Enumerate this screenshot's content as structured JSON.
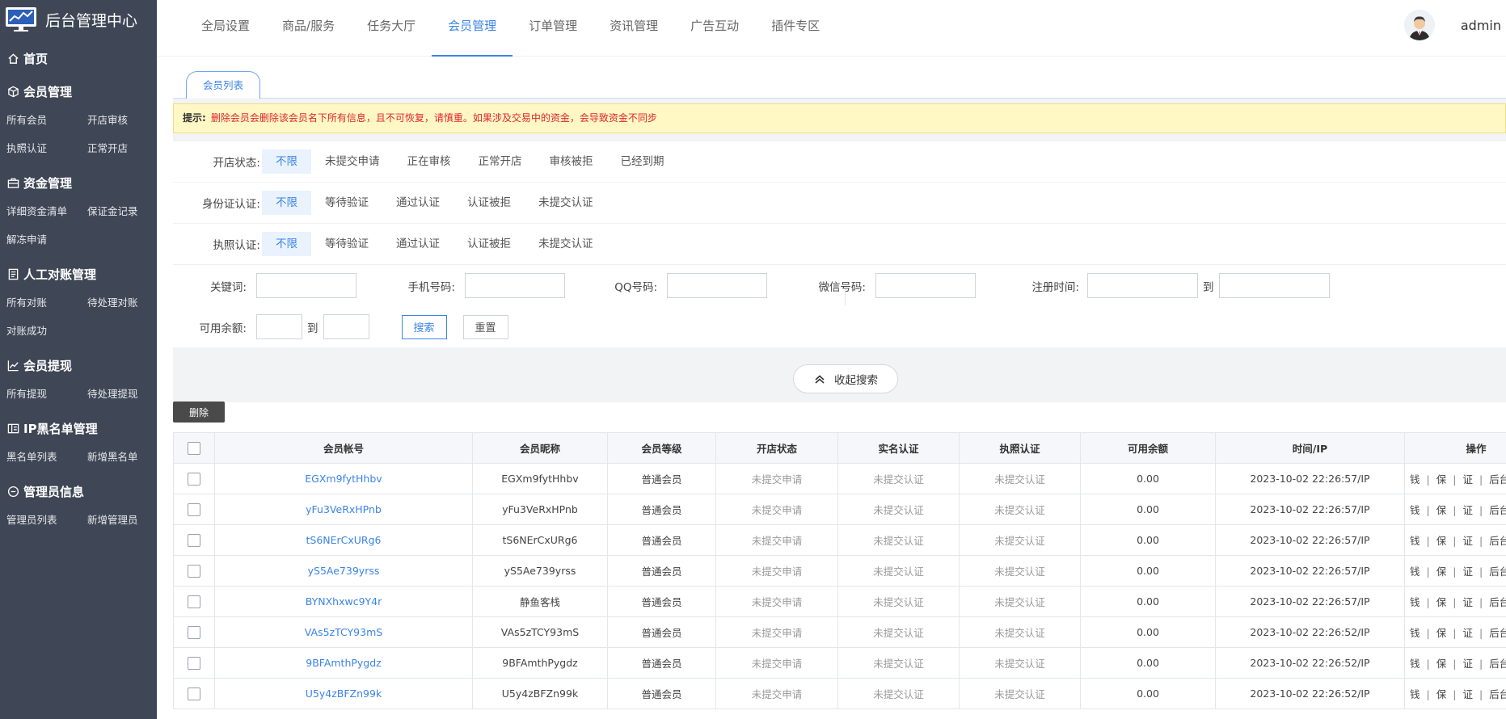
{
  "brand": {
    "title": "后台管理中心"
  },
  "sidebar": {
    "home": "首页",
    "groups": [
      {
        "title": "会员管理",
        "icon": "cube-icon",
        "items": [
          "所有会员",
          "开店审核",
          "执照认证",
          "正常开店"
        ]
      },
      {
        "title": "资金管理",
        "icon": "briefcase-icon",
        "items": [
          "详细资金清单",
          "保证金记录",
          "解冻申请"
        ]
      },
      {
        "title": "人工对账管理",
        "icon": "document-icon",
        "items": [
          "所有对账",
          "待处理对账",
          "对账成功"
        ]
      },
      {
        "title": "会员提现",
        "icon": "trend-chart-icon",
        "items": [
          "所有提现",
          "待处理提现"
        ]
      },
      {
        "title": "IP黑名单管理",
        "icon": "blacklist-icon",
        "items": [
          "黑名单列表",
          "新增黑名单"
        ]
      },
      {
        "title": "管理员信息",
        "icon": "minus-circle-icon",
        "items": [
          "管理员列表",
          "新增管理员"
        ]
      }
    ]
  },
  "topnav": {
    "items": [
      "全局设置",
      "商品/服务",
      "任务大厅",
      "会员管理",
      "订单管理",
      "资讯管理",
      "广告互动",
      "插件专区"
    ],
    "active_index": 3
  },
  "user": {
    "name": "admin"
  },
  "tab": {
    "label": "会员列表"
  },
  "notice": {
    "label": "提示:",
    "text": "删除会员会删除该会员名下所有信息，且不可恢复，请慎重。如果涉及交易中的资金，会导致资金不同步"
  },
  "filters": {
    "shop_status": {
      "label": "开店状态:",
      "options": [
        "不限",
        "未提交申请",
        "正在审核",
        "正常开店",
        "审核被拒",
        "已经到期"
      ],
      "active": 0
    },
    "id_auth": {
      "label": "身份证认证:",
      "options": [
        "不限",
        "等待验证",
        "通过认证",
        "认证被拒",
        "未提交认证"
      ],
      "active": 0
    },
    "license_auth": {
      "label": "执照认证:",
      "options": [
        "不限",
        "等待验证",
        "通过认证",
        "认证被拒",
        "未提交认证"
      ],
      "active": 0
    },
    "keyword_label": "关键词:",
    "phone_label": "手机号码:",
    "qq_label": "QQ号码:",
    "wechat_label": "微信号码:",
    "regtime_label": "注册时间:",
    "to_label": "到",
    "balance_label": "可用余额:",
    "search_btn": "搜索",
    "reset_btn": "重置"
  },
  "collapse": {
    "label": "收起搜索"
  },
  "delete_btn": "删除",
  "table": {
    "headers": [
      "会员帐号",
      "会员昵称",
      "会员等级",
      "开店状态",
      "实名认证",
      "执照认证",
      "可用余额",
      "时间/IP",
      "操作"
    ],
    "ops": [
      "钱",
      "保",
      "证",
      "后台"
    ],
    "rows": [
      {
        "account": "EGXm9fytHhbv",
        "nickname": "EGXm9fytHhbv",
        "level": "普通会员",
        "shop": "未提交申请",
        "realname": "未提交认证",
        "license": "未提交认证",
        "balance": "0.00",
        "time": "2023-10-02 22:26:57/IP"
      },
      {
        "account": "yFu3VeRxHPnb",
        "nickname": "yFu3VeRxHPnb",
        "level": "普通会员",
        "shop": "未提交申请",
        "realname": "未提交认证",
        "license": "未提交认证",
        "balance": "0.00",
        "time": "2023-10-02 22:26:57/IP"
      },
      {
        "account": "tS6NErCxURg6",
        "nickname": "tS6NErCxURg6",
        "level": "普通会员",
        "shop": "未提交申请",
        "realname": "未提交认证",
        "license": "未提交认证",
        "balance": "0.00",
        "time": "2023-10-02 22:26:57/IP"
      },
      {
        "account": "yS5Ae739yrss",
        "nickname": "yS5Ae739yrss",
        "level": "普通会员",
        "shop": "未提交申请",
        "realname": "未提交认证",
        "license": "未提交认证",
        "balance": "0.00",
        "time": "2023-10-02 22:26:57/IP"
      },
      {
        "account": "BYNXhxwc9Y4r",
        "nickname": "静鱼客栈",
        "level": "普通会员",
        "shop": "未提交申请",
        "realname": "未提交认证",
        "license": "未提交认证",
        "balance": "0.00",
        "time": "2023-10-02 22:26:57/IP"
      },
      {
        "account": "VAs5zTCY93mS",
        "nickname": "VAs5zTCY93mS",
        "level": "普通会员",
        "shop": "未提交申请",
        "realname": "未提交认证",
        "license": "未提交认证",
        "balance": "0.00",
        "time": "2023-10-02 22:26:52/IP"
      },
      {
        "account": "9BFAmthPygdz",
        "nickname": "9BFAmthPygdz",
        "level": "普通会员",
        "shop": "未提交申请",
        "realname": "未提交认证",
        "license": "未提交认证",
        "balance": "0.00",
        "time": "2023-10-02 22:26:52/IP"
      },
      {
        "account": "U5y4zBFZn99k",
        "nickname": "U5y4zBFZn99k",
        "level": "普通会员",
        "shop": "未提交申请",
        "realname": "未提交认证",
        "license": "未提交认证",
        "balance": "0.00",
        "time": "2023-10-02 22:26:52/IP"
      }
    ]
  },
  "colors": {
    "accent": "#3b84e6",
    "sidebar_bg": "#3f4756",
    "warning": "#e0242b",
    "notice_bg": "#fff8c5"
  }
}
